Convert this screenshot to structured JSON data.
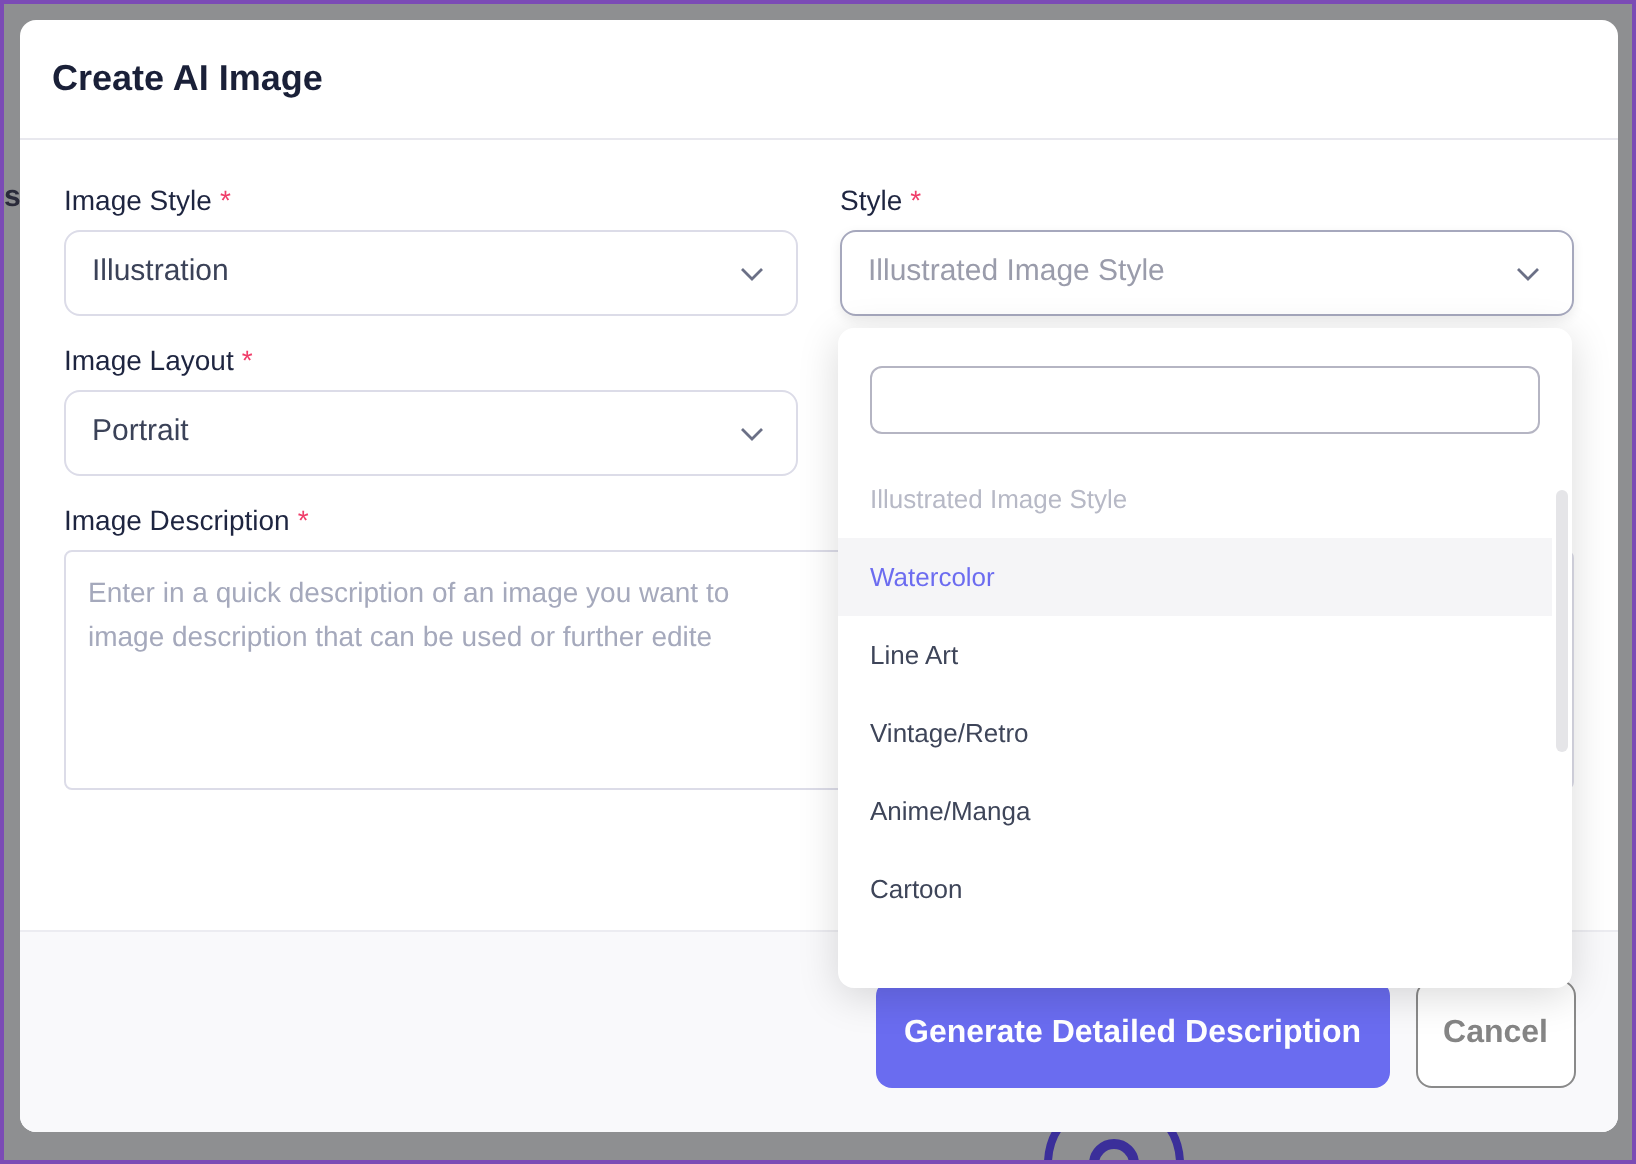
{
  "backdrop": {
    "text_fragment": "s"
  },
  "dialog": {
    "title": "Create AI Image"
  },
  "fields": [
    {
      "kind": "select",
      "label": "Image Style",
      "required_mark": "*",
      "value": "Illustration",
      "open": false
    },
    {
      "kind": "select",
      "label": "Style",
      "required_mark": "*",
      "placeholder": "Illustrated Image Style",
      "open": true
    },
    {
      "kind": "select",
      "label": "Image Layout",
      "required_mark": "*",
      "value": "Portrait",
      "open": false
    },
    {
      "kind": "textarea",
      "label": "Image Description",
      "required_mark": "*",
      "placeholder_lines": [
        "Enter in a quick description of an image you want to",
        "image description that can be used or further edite"
      ]
    }
  ],
  "dropdown": {
    "options": [
      {
        "label": "Illustrated Image Style",
        "disabled": true,
        "selected": false
      },
      {
        "label": "Watercolor",
        "disabled": false,
        "selected": true
      },
      {
        "label": "Line Art",
        "disabled": false,
        "selected": false
      },
      {
        "label": "Vintage/Retro",
        "disabled": false,
        "selected": false
      },
      {
        "label": "Anime/Manga",
        "disabled": false,
        "selected": false
      },
      {
        "label": "Cartoon",
        "disabled": false,
        "selected": false
      }
    ]
  },
  "buttons": [
    {
      "kind": "primary",
      "label": "Generate Detailed Description"
    },
    {
      "kind": "secondary",
      "label": "Cancel"
    }
  ]
}
